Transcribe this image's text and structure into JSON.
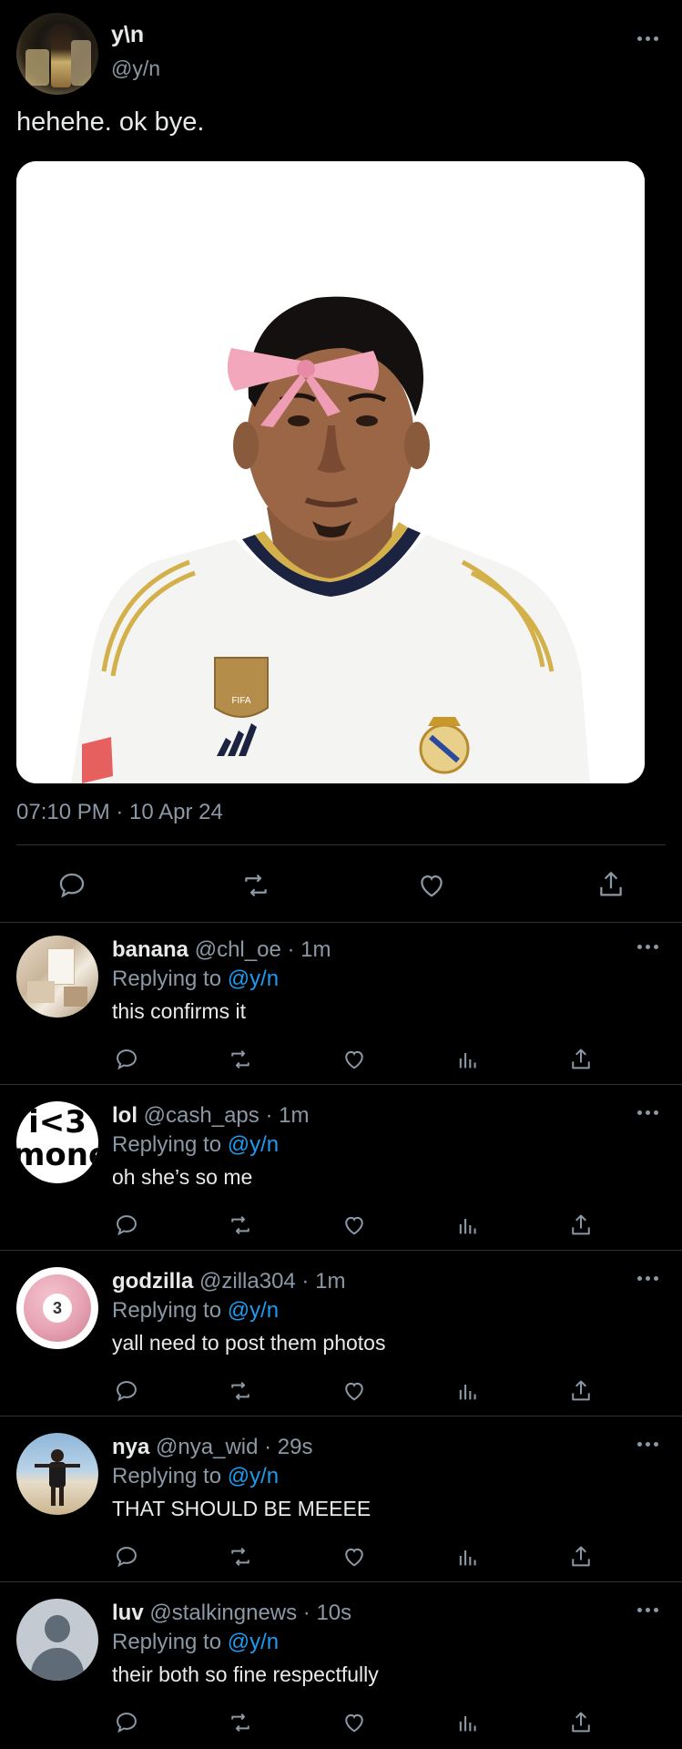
{
  "post": {
    "author_name": "y\\n",
    "author_handle": "@y/n",
    "text": "hehehe. ok bye.",
    "timestamp": "07:10 PM · 10 Apr 24",
    "media_icons": {
      "badge": "FIFA",
      "brand": "adidas-logo",
      "crest": "real-madrid-crest"
    }
  },
  "replies": [
    {
      "name": "banana",
      "handle": "@chl_oe",
      "time": "1m",
      "replying_label": "Replying to",
      "mention": "@y/n",
      "text": "this confirms it",
      "avatar": "collage-avatar"
    },
    {
      "name": "lol",
      "handle": "@cash_aps",
      "time": "1m",
      "replying_label": "Replying to",
      "mention": "@y/n",
      "text": "oh she’s so me",
      "avatar": "i-love-money-avatar",
      "avatar_text_top": "i<3",
      "avatar_text_bottom": "mone"
    },
    {
      "name": "godzilla",
      "handle": "@zilla304",
      "time": "1m",
      "replying_label": "Replying to",
      "mention": "@y/n",
      "text": "yall need to post them photos",
      "avatar": "pool-ball-avatar",
      "avatar_text": "3"
    },
    {
      "name": "nya",
      "handle": "@nya_wid",
      "time": "29s",
      "replying_label": "Replying to",
      "mention": "@y/n",
      "text": "THAT SHOULD BE MEEEE",
      "avatar": "beach-person-avatar"
    },
    {
      "name": "luv",
      "handle": "@stalkingnews",
      "time": "10s",
      "replying_label": "Replying to",
      "mention": "@y/n",
      "text": "their both so fine respectfully",
      "avatar": "default-avatar"
    }
  ],
  "colors": {
    "background": "#000000",
    "text": "#e7e9ea",
    "muted": "#8b98a5",
    "link": "#1d9bf0",
    "divider": "#2f3336"
  }
}
